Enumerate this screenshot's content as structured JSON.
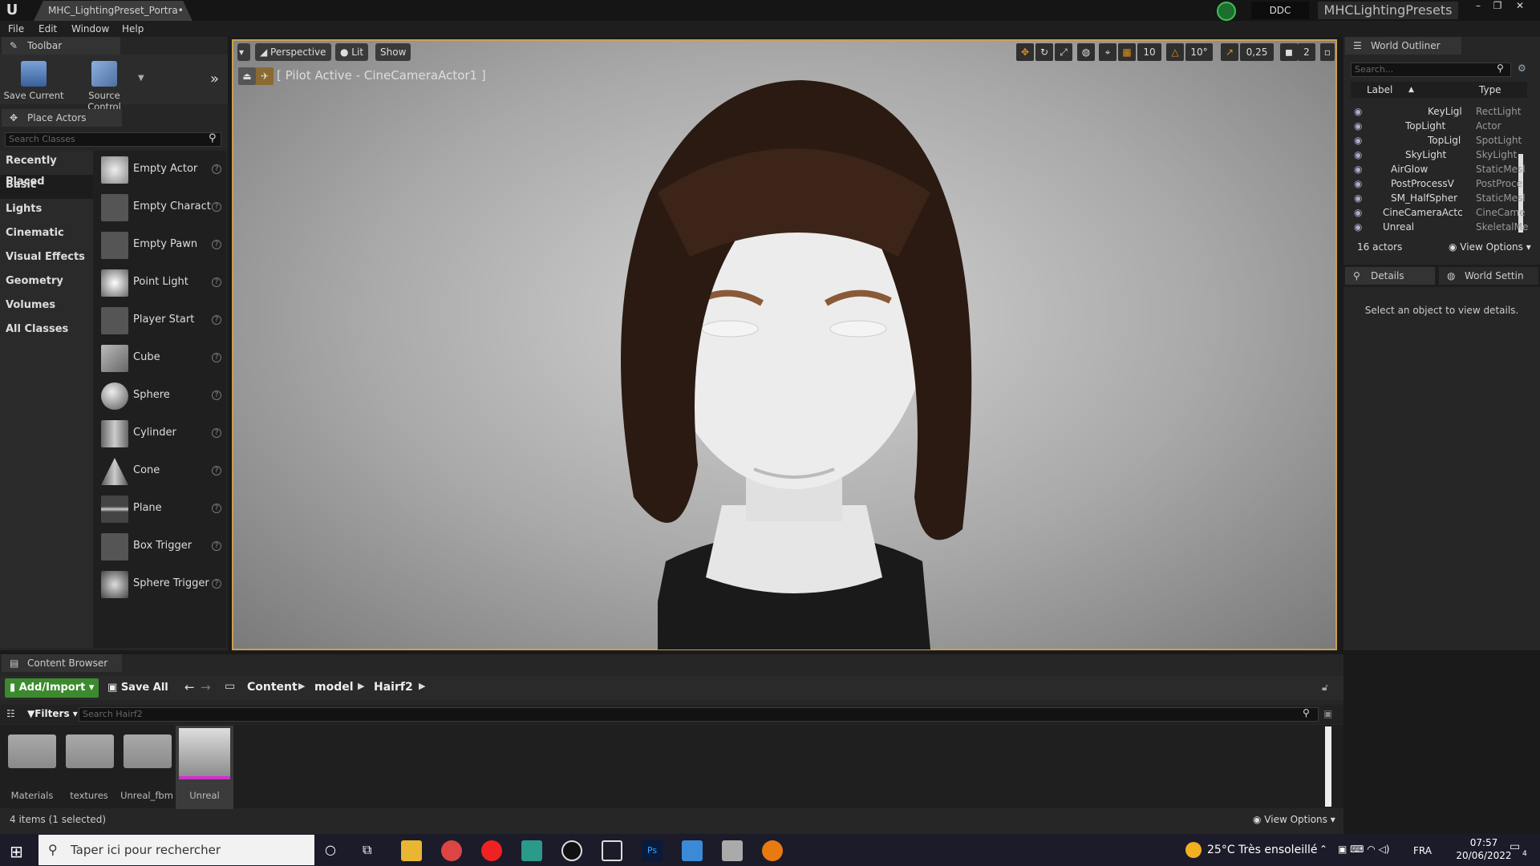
{
  "titlebar": {
    "tab": "MHC_LightingPreset_Portra•",
    "ddc": "DDC",
    "project": "MHCLightingPresets"
  },
  "menu": [
    "File",
    "Edit",
    "Window",
    "Help"
  ],
  "toolbar": {
    "tab": "Toolbar",
    "save_current": "Save Current",
    "source_control": "Source Control"
  },
  "place_actors": {
    "tab": "Place Actors",
    "search_placeholder": "Search Classes",
    "categories": [
      "Recently Placed",
      "Basic",
      "Lights",
      "Cinematic",
      "Visual Effects",
      "Geometry",
      "Volumes",
      "All Classes"
    ],
    "items": [
      "Empty Actor",
      "Empty Charact",
      "Empty Pawn",
      "Point Light",
      "Player Start",
      "Cube",
      "Sphere",
      "Cylinder",
      "Cone",
      "Plane",
      "Box Trigger",
      "Sphere Trigger"
    ]
  },
  "viewport": {
    "perspective": "Perspective",
    "lit": "Lit",
    "show": "Show",
    "pilot": "[ Pilot Active - CineCameraActor1 ]",
    "grid": "10",
    "angle": "10°",
    "scale": "0,25",
    "cam_speed": "2"
  },
  "world_outliner": {
    "tab": "World Outliner",
    "search_placeholder": "Search...",
    "col_label": "Label",
    "col_type": "Type",
    "rows": [
      {
        "label": "KeyLigl",
        "type": "RectLight"
      },
      {
        "label": "TopLight",
        "type": "Actor"
      },
      {
        "label": "TopLigl",
        "type": "SpotLight"
      },
      {
        "label": "SkyLight",
        "type": "SkyLight"
      },
      {
        "label": "AirGlow",
        "type": "StaticMesl"
      },
      {
        "label": "PostProcessV",
        "type": "PostProce"
      },
      {
        "label": "SM_HalfSpher",
        "type": "StaticMesl"
      },
      {
        "label": "CineCameraActc",
        "type": "CineCame"
      },
      {
        "label": "Unreal",
        "type": "SkeletalMe"
      }
    ],
    "count": "16 actors",
    "view_options": "View Options"
  },
  "details": {
    "tab1": "Details",
    "tab2": "World Settin",
    "empty": "Select an object to view details."
  },
  "content_browser": {
    "tab": "Content Browser",
    "add_import": "Add/Import",
    "save_all": "Save All",
    "path": [
      "Content",
      "model",
      "Hairf2"
    ],
    "filters": "Filters",
    "search_placeholder": "Search Hairf2",
    "assets": [
      "Materials",
      "textures",
      "Unreal_fbm",
      "Unreal"
    ],
    "status": "4 items (1 selected)",
    "view_options": "View Options"
  },
  "taskbar": {
    "search": "Taper ici pour rechercher",
    "weather": "25°C  Très ensoleillé",
    "lang": "FRA",
    "time": "07:57",
    "date": "20/06/2022",
    "notifications": "4"
  },
  "colors": {
    "viewport_border": "#c8a050",
    "add_import_green": "#3c8a2e",
    "accent_orange": "#e0901c"
  }
}
